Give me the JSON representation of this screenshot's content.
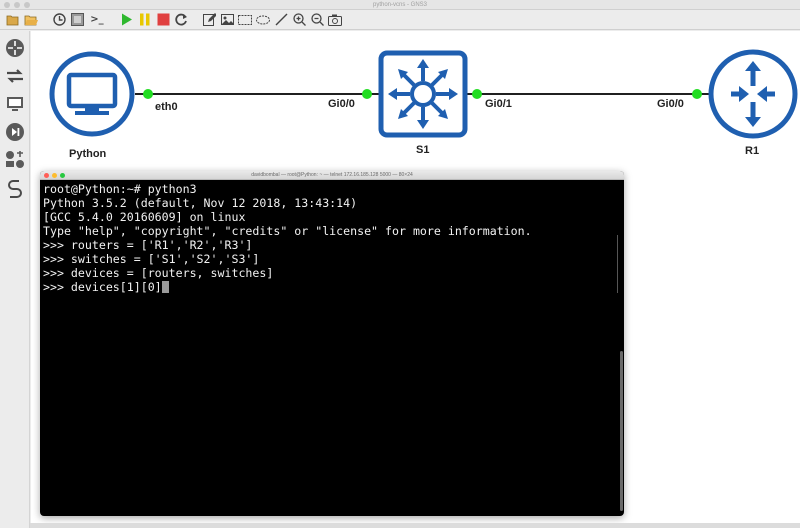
{
  "window": {
    "title": "python-vcns - GNS3"
  },
  "toolbar": {
    "items": [
      {
        "name": "new-project-icon",
        "glyph": "📂"
      },
      {
        "name": "open-project-icon",
        "glyph": "📁"
      },
      {
        "name": "snapshot-icon",
        "glyph": "🕓"
      },
      {
        "name": "show-interface-labels-icon",
        "glyph": "▦"
      },
      {
        "name": "console-all-icon",
        "glyph": ">_"
      },
      {
        "name": "start-all-icon",
        "glyph": "▶"
      },
      {
        "name": "suspend-all-icon",
        "glyph": "❚❚"
      },
      {
        "name": "stop-all-icon",
        "glyph": "■"
      },
      {
        "name": "reload-all-icon",
        "glyph": "↻"
      },
      {
        "name": "add-note-icon",
        "glyph": "✎"
      },
      {
        "name": "insert-picture-icon",
        "glyph": "▣"
      },
      {
        "name": "draw-rectangle-icon",
        "glyph": "▭"
      },
      {
        "name": "draw-ellipse-icon",
        "glyph": "⬭"
      },
      {
        "name": "draw-line-icon",
        "glyph": "╱"
      },
      {
        "name": "zoom-in-icon",
        "glyph": "⊕"
      },
      {
        "name": "zoom-out-icon",
        "glyph": "⊖"
      },
      {
        "name": "screenshot-icon",
        "glyph": "⎙"
      }
    ],
    "colors": {
      "start": "#2fb82f",
      "suspend": "#e8c800",
      "stop": "#e04040"
    }
  },
  "dock": {
    "items": [
      {
        "name": "browse-routers-icon"
      },
      {
        "name": "browse-switches-icon"
      },
      {
        "name": "browse-end-devices-icon"
      },
      {
        "name": "browse-security-devices-icon"
      },
      {
        "name": "browse-all-devices-icon"
      },
      {
        "name": "add-link-icon"
      }
    ]
  },
  "topology": {
    "nodes": [
      {
        "id": "python",
        "label": "Python",
        "type": "end-device"
      },
      {
        "id": "s1",
        "label": "S1",
        "type": "switch"
      },
      {
        "id": "r1",
        "label": "R1",
        "type": "router"
      }
    ],
    "links": [
      {
        "from_port": "eth0",
        "to_port": "Gi0/0"
      },
      {
        "from_port": "Gi0/1",
        "to_port": "Gi0/0"
      }
    ],
    "colors": {
      "device": "#1f5fb0",
      "link": "#000000",
      "port_up": "#22dd22"
    }
  },
  "terminal": {
    "title": "davidbombal — root@Python: ~ — telnet 172.16.185.128 5000 — 80×24",
    "lines": [
      "root@Python:~# python3",
      "Python 3.5.2 (default, Nov 12 2018, 13:43:14)",
      "[GCC 5.4.0 20160609] on linux",
      "Type \"help\", \"copyright\", \"credits\" or \"license\" for more information.",
      ">>> routers = ['R1','R2','R3']",
      ">>> switches = ['S1','S2','S3']",
      ">>> devices = [routers, switches]",
      ">>> devices[1][0]"
    ],
    "colors": {
      "bg": "#000000",
      "fg": "#f2f2f2"
    }
  }
}
